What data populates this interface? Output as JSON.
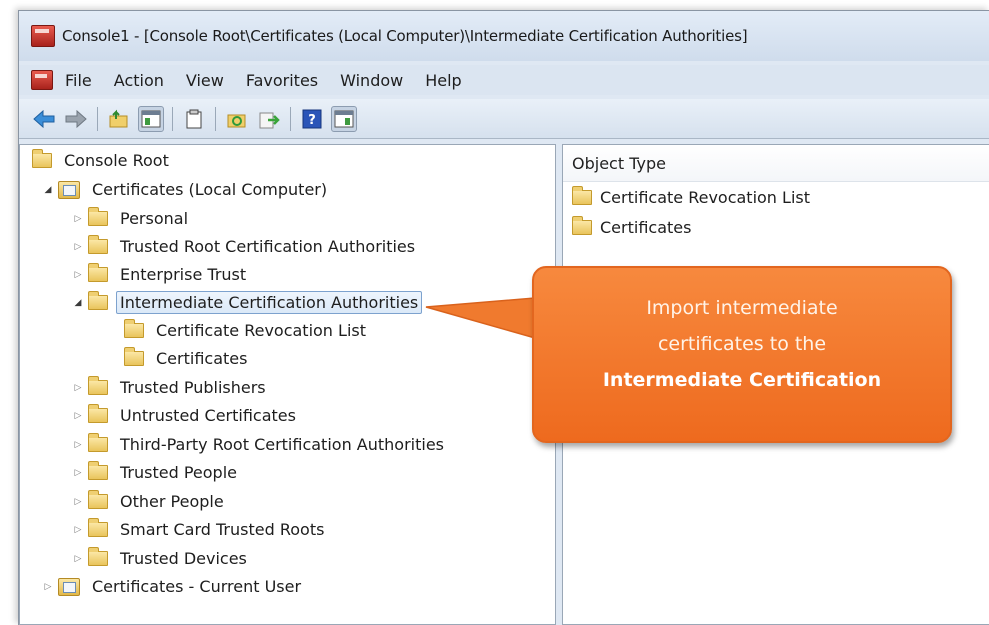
{
  "window": {
    "title": "Console1 - [Console Root\\Certificates (Local Computer)\\Intermediate Certification Authorities]"
  },
  "menu": [
    "File",
    "Action",
    "View",
    "Favorites",
    "Window",
    "Help"
  ],
  "toolbar_icons": [
    "back-arrow",
    "forward-arrow",
    "up-folder",
    "show-hide-console-tree",
    "properties",
    "refresh",
    "export-list",
    "help",
    "show-hide-action-pane"
  ],
  "tree": {
    "root": "Console Root",
    "local_computer": "Certificates (Local Computer)",
    "personal": "Personal",
    "trusted_root": "Trusted Root Certification Authorities",
    "enterprise_trust": "Enterprise Trust",
    "intermediate": "Intermediate Certification Authorities",
    "crl": "Certificate Revocation List",
    "certificates": "Certificates",
    "trusted_publishers": "Trusted Publishers",
    "untrusted": "Untrusted Certificates",
    "third_party_root": "Third-Party Root Certification Authorities",
    "trusted_people": "Trusted People",
    "other_people": "Other People",
    "smart_card": "Smart Card Trusted Roots",
    "trusted_devices": "Trusted Devices",
    "current_user": "Certificates - Current User"
  },
  "details": {
    "column_header": "Object Type",
    "items": [
      "Certificate Revocation List",
      "Certificates"
    ]
  },
  "callout": {
    "line1": "Import intermediate",
    "line2": "certificates to the",
    "line3": "Intermediate Certification"
  },
  "colors": {
    "callout_orange": "#f07a2e",
    "selection_border": "#7da2ce"
  }
}
